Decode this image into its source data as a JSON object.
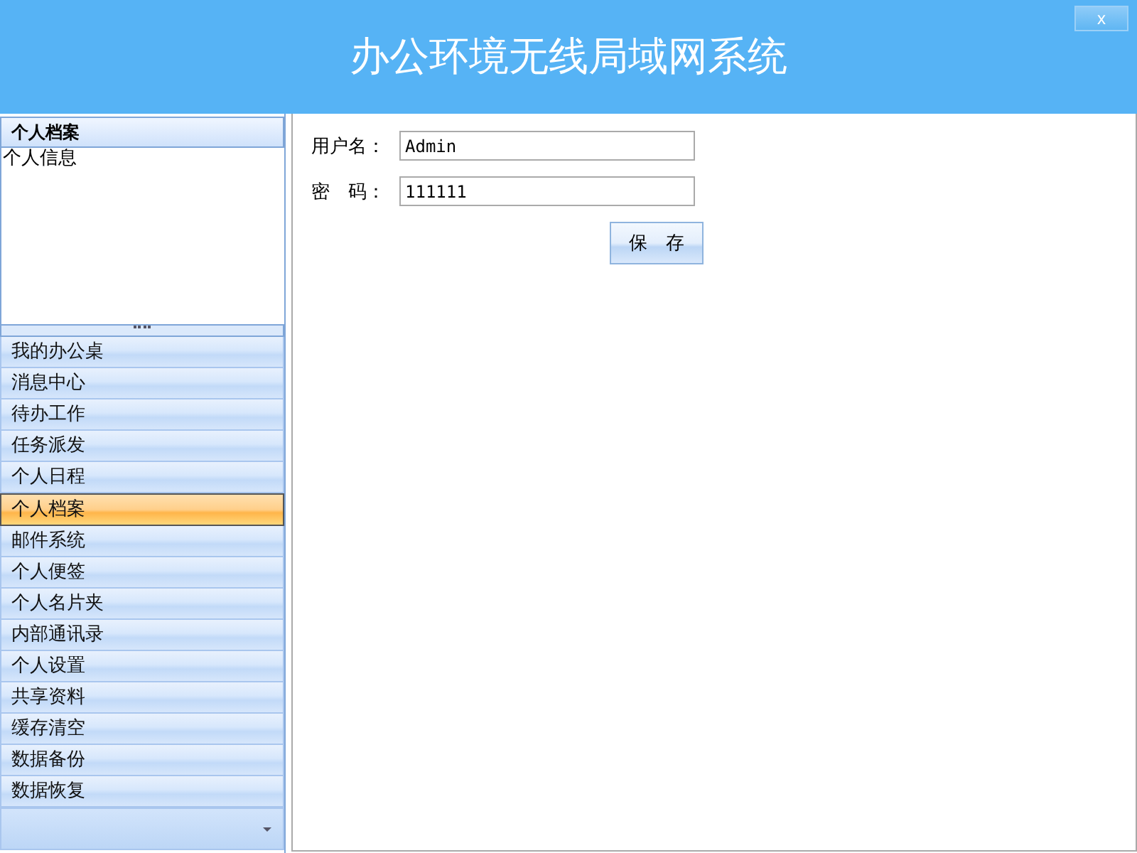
{
  "window": {
    "title": "办公环境无线局域网系统",
    "close": "x"
  },
  "panel": {
    "title": "个人档案",
    "items": [
      {
        "label": "个人信息",
        "selected": false
      }
    ]
  },
  "nav": [
    {
      "label": "我的办公桌",
      "selected": false
    },
    {
      "label": "消息中心",
      "selected": false
    },
    {
      "label": "待办工作",
      "selected": false
    },
    {
      "label": "任务派发",
      "selected": false
    },
    {
      "label": "个人日程",
      "selected": false
    },
    {
      "label": "个人档案",
      "selected": true
    },
    {
      "label": "邮件系统",
      "selected": false
    },
    {
      "label": "个人便签",
      "selected": false
    },
    {
      "label": "个人名片夹",
      "selected": false
    },
    {
      "label": "内部通讯录",
      "selected": false
    },
    {
      "label": "个人设置",
      "selected": false
    },
    {
      "label": "共享资料",
      "selected": false
    },
    {
      "label": "缓存清空",
      "selected": false
    },
    {
      "label": "数据备份",
      "selected": false
    },
    {
      "label": "数据恢复",
      "selected": false
    }
  ],
  "form": {
    "fields": [
      {
        "label": "用户名：",
        "value": "Admin"
      },
      {
        "label": "密　码：",
        "value": "111111"
      }
    ],
    "save": "保　存"
  }
}
